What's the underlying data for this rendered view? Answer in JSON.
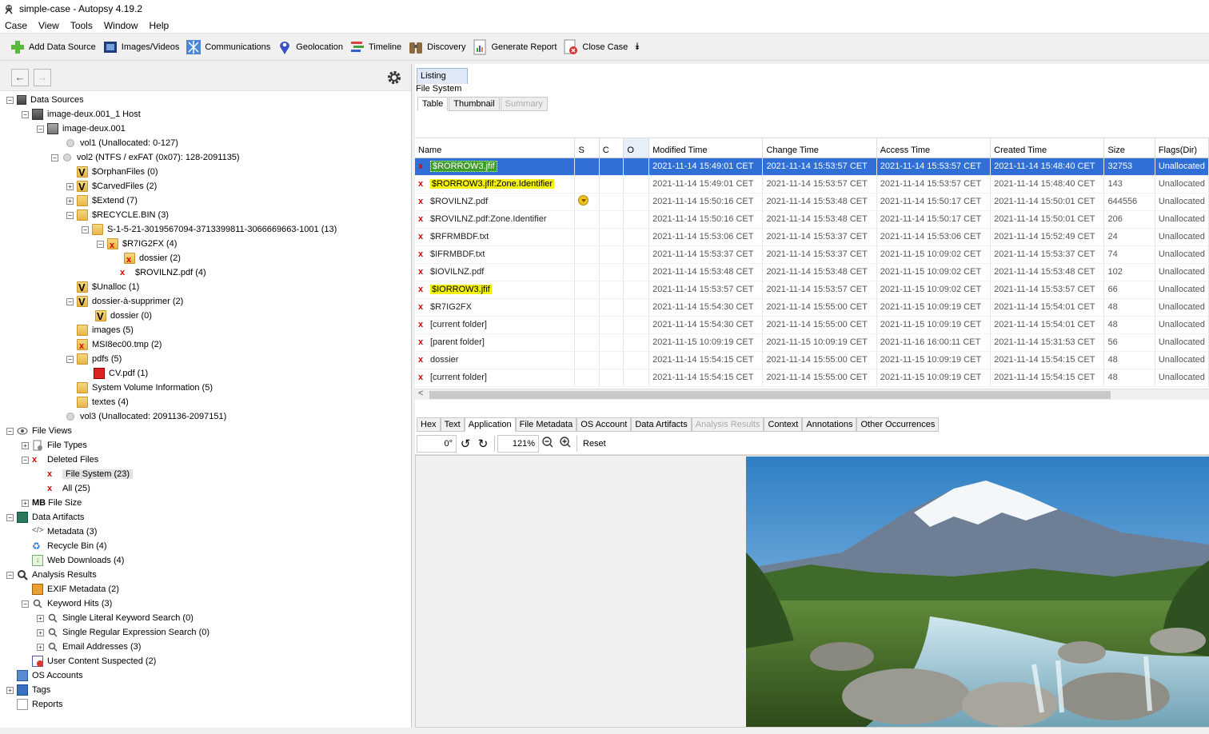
{
  "window": {
    "title": "simple-case - Autopsy 4.19.2"
  },
  "menu": [
    "Case",
    "View",
    "Tools",
    "Window",
    "Help"
  ],
  "toolbar": {
    "add_data_source": "Add Data Source",
    "images_videos": "Images/Videos",
    "communications": "Communications",
    "geolocation": "Geolocation",
    "timeline": "Timeline",
    "discovery": "Discovery",
    "generate_report": "Generate Report",
    "close_case": "Close Case"
  },
  "tree": {
    "data_sources": "Data Sources",
    "host": "image-deux.001_1 Host",
    "image": "image-deux.001",
    "vol1": "vol1 (Unallocated: 0-127)",
    "vol2": "vol2 (NTFS / exFAT (0x07): 128-2091135)",
    "orphan": "$OrphanFiles (0)",
    "carved": "$CarvedFiles (2)",
    "extend": "$Extend (7)",
    "recycle": "$RECYCLE.BIN (3)",
    "sid": "S-1-5-21-3019567094-3713399811-3066669663-1001 (13)",
    "r7ig2fx": "$R7IG2FX (4)",
    "dossier2": "dossier (2)",
    "rovilnz": "$ROVILNZ.pdf (4)",
    "unalloc": "$Unalloc (1)",
    "dossier_supp": "dossier-à-supprimer (2)",
    "dossier0": "dossier (0)",
    "images": "images (5)",
    "msi": "MSI8ec00.tmp (2)",
    "pdfs": "pdfs (5)",
    "cv": "CV.pdf (1)",
    "svi": "System Volume Information (5)",
    "textes": "textes (4)",
    "vol3": "vol3 (Unallocated: 2091136-2097151)",
    "file_views": "File Views",
    "file_types": "File Types",
    "deleted_files": "Deleted Files",
    "file_system": "File System (23)",
    "all": "All (25)",
    "mb": "MB",
    "file_size": "File Size",
    "data_artifacts": "Data Artifacts",
    "metadata": "Metadata (3)",
    "recycle_bin": "Recycle Bin (4)",
    "web_downloads": "Web Downloads (4)",
    "analysis_results": "Analysis Results",
    "exif": "EXIF Metadata (2)",
    "keyword_hits": "Keyword Hits (3)",
    "single_literal": "Single Literal Keyword Search (0)",
    "single_regex": "Single Regular Expression Search (0)",
    "email": "Email Addresses (3)",
    "user_content": "User Content Suspected (2)",
    "os_accounts": "OS Accounts",
    "tags": "Tags",
    "reports": "Reports"
  },
  "listing": {
    "tab": "Listing",
    "path": "File System",
    "subtabs": [
      "Table",
      "Thumbnail",
      "Summary"
    ],
    "columns": [
      "Name",
      "S",
      "C",
      "O",
      "Modified Time",
      "Change Time",
      "Access Time",
      "Created Time",
      "Size",
      "Flags(Dir)"
    ],
    "rows": [
      [
        "$RORROW3.jfif",
        "",
        "",
        "",
        "2021-11-14 15:49:01 CET",
        "2021-11-14 15:53:57 CET",
        "2021-11-14 15:53:57 CET",
        "2021-11-14 15:48:40 CET",
        "32753",
        "Unallocated"
      ],
      [
        "$RORROW3.jfif:Zone.Identifier",
        "",
        "",
        "",
        "2021-11-14 15:49:01 CET",
        "2021-11-14 15:53:57 CET",
        "2021-11-14 15:53:57 CET",
        "2021-11-14 15:48:40 CET",
        "143",
        "Unallocated"
      ],
      [
        "$ROVILNZ.pdf",
        "",
        "",
        "",
        "2021-11-14 15:50:16 CET",
        "2021-11-14 15:53:48 CET",
        "2021-11-14 15:50:17 CET",
        "2021-11-14 15:50:01 CET",
        "644556",
        "Unallocated"
      ],
      [
        "$ROVILNZ.pdf:Zone.Identifier",
        "",
        "",
        "",
        "2021-11-14 15:50:16 CET",
        "2021-11-14 15:53:48 CET",
        "2021-11-14 15:50:17 CET",
        "2021-11-14 15:50:01 CET",
        "206",
        "Unallocated"
      ],
      [
        "$RFRMBDF.txt",
        "",
        "",
        "",
        "2021-11-14 15:53:06 CET",
        "2021-11-14 15:53:37 CET",
        "2021-11-14 15:53:06 CET",
        "2021-11-14 15:52:49 CET",
        "24",
        "Unallocated"
      ],
      [
        "$IFRMBDF.txt",
        "",
        "",
        "",
        "2021-11-14 15:53:37 CET",
        "2021-11-14 15:53:37 CET",
        "2021-11-15 10:09:02 CET",
        "2021-11-14 15:53:37 CET",
        "74",
        "Unallocated"
      ],
      [
        "$IOVILNZ.pdf",
        "",
        "",
        "",
        "2021-11-14 15:53:48 CET",
        "2021-11-14 15:53:48 CET",
        "2021-11-15 10:09:02 CET",
        "2021-11-14 15:53:48 CET",
        "102",
        "Unallocated"
      ],
      [
        "$IORROW3.jfif",
        "",
        "",
        "",
        "2021-11-14 15:53:57 CET",
        "2021-11-14 15:53:57 CET",
        "2021-11-15 10:09:02 CET",
        "2021-11-14 15:53:57 CET",
        "66",
        "Unallocated"
      ],
      [
        "$R7IG2FX",
        "",
        "",
        "",
        "2021-11-14 15:54:30 CET",
        "2021-11-14 15:55:00 CET",
        "2021-11-15 10:09:19 CET",
        "2021-11-14 15:54:01 CET",
        "48",
        "Unallocated"
      ],
      [
        "[current folder]",
        "",
        "",
        "",
        "2021-11-14 15:54:30 CET",
        "2021-11-14 15:55:00 CET",
        "2021-11-15 10:09:19 CET",
        "2021-11-14 15:54:01 CET",
        "48",
        "Unallocated"
      ],
      [
        "[parent folder]",
        "",
        "",
        "",
        "2021-11-15 10:09:19 CET",
        "2021-11-15 10:09:19 CET",
        "2021-11-16 16:00:11 CET",
        "2021-11-14 15:31:53 CET",
        "56",
        "Unallocated"
      ],
      [
        "dossier",
        "",
        "",
        "",
        "2021-11-14 15:54:15 CET",
        "2021-11-14 15:55:00 CET",
        "2021-11-15 10:09:19 CET",
        "2021-11-14 15:54:15 CET",
        "48",
        "Unallocated"
      ],
      [
        "[current folder]",
        "",
        "",
        "",
        "2021-11-14 15:54:15 CET",
        "2021-11-14 15:55:00 CET",
        "2021-11-15 10:09:19 CET",
        "2021-11-14 15:54:15 CET",
        "48",
        "Unallocated"
      ]
    ]
  },
  "content_viewer": {
    "tabs": [
      "Hex",
      "Text",
      "Application",
      "File Metadata",
      "OS Account",
      "Data Artifacts",
      "Analysis Results",
      "Context",
      "Annotations",
      "Other Occurrences"
    ],
    "rotation": "0°",
    "zoom": "121%",
    "reset": "Reset"
  }
}
